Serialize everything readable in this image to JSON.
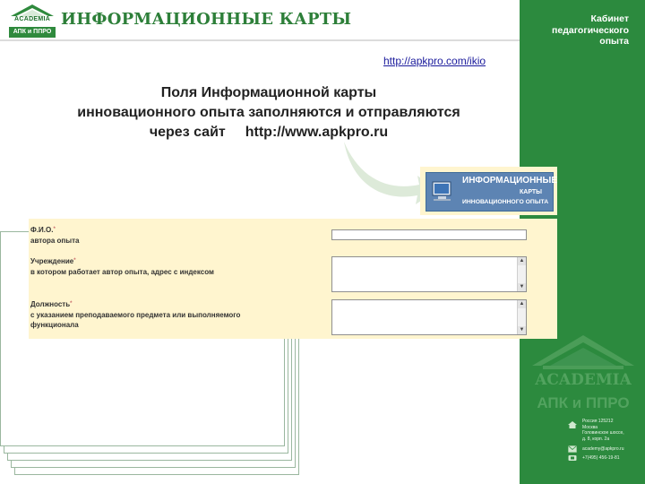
{
  "header": {
    "logo_academia": "ACADEMIA",
    "logo_subtitle": "АПК и ППРО",
    "title": "ИНФОРМАЦИОННЫЕ КАРТЫ"
  },
  "sidebar": {
    "title_lines": [
      "Кабинет",
      "педагогического",
      "опыта"
    ],
    "logo_academia": "ACADEMIA",
    "logo_subtitle": "АПК и ППРО",
    "address_lines": [
      "Россия    125212",
      "Москва",
      "Головинское шоссе,",
      "д. 8, корп. 2а"
    ],
    "email": "academy@apkpro.ru",
    "phone": "+7(495) 456-19-81"
  },
  "top_link": "http://apkpro.com/ikio",
  "headline": {
    "line1": "Поля Информационной карты",
    "line2": "инновационного опыта заполняются и отправляются",
    "line3_text": "через сайт",
    "line3_url": "http://www.apkpro.ru"
  },
  "banner": {
    "line1": "ИНФОРМАЦИОННЫЕ",
    "line2": "КАРТЫ",
    "line3": "ИННОВАЦИОННОГО ОПЫТА"
  },
  "form": {
    "fields": [
      {
        "label": "Ф.И.О.",
        "sublabel": "автора опыта",
        "required_mark": "*",
        "value": ""
      },
      {
        "label": "Учреждение",
        "sublabel": "в котором работает автор опыта, адрес с индексом",
        "required_mark": "*",
        "value": ""
      },
      {
        "label": "Должность",
        "sublabel_1": "с указанием преподаваемого предмета или выполняемого",
        "sublabel_2": "функционала",
        "required_mark": "*",
        "value": ""
      }
    ]
  },
  "icons": {
    "scroll_up": "▲",
    "scroll_down": "▼"
  },
  "colors": {
    "brand_green": "#2c8a3e",
    "form_background": "#fff5cf",
    "banner_blue": "#5d84b3",
    "link_blue": "#1a1a9c"
  }
}
